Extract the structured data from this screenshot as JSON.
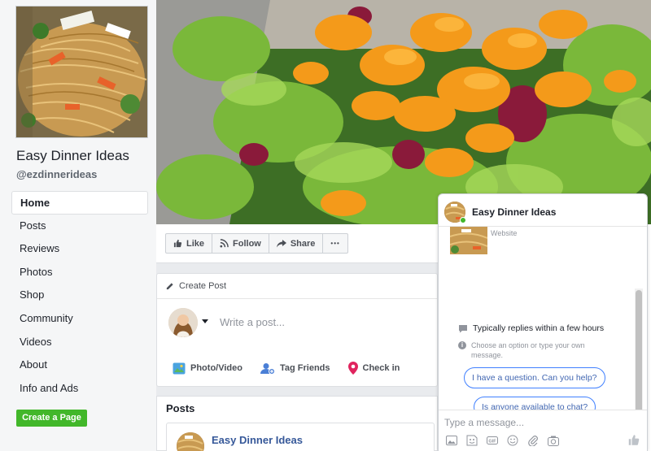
{
  "page": {
    "name": "Easy Dinner Ideas",
    "handle": "@ezdinnerideas"
  },
  "nav": {
    "items": [
      {
        "label": "Home",
        "active": true
      },
      {
        "label": "Posts"
      },
      {
        "label": "Reviews"
      },
      {
        "label": "Photos"
      },
      {
        "label": "Shop"
      },
      {
        "label": "Community"
      },
      {
        "label": "Videos"
      },
      {
        "label": "About"
      },
      {
        "label": "Info and Ads"
      }
    ],
    "create_page_label": "Create a Page"
  },
  "actions": {
    "like_label": "Like",
    "follow_label": "Follow",
    "share_label": "Share",
    "more_label": "•••"
  },
  "create_post": {
    "title": "Create Post",
    "placeholder": "Write a post...",
    "photo_video_label": "Photo/Video",
    "tag_friends_label": "Tag Friends",
    "check_in_label": "Check in"
  },
  "posts": {
    "title": "Posts",
    "first_author": "Easy Dinner Ideas"
  },
  "chat": {
    "title": "Easy Dinner Ideas",
    "site_label": "Website",
    "reply_note": "Typically replies within a few hours",
    "option_note": "Choose an option or type your own message.",
    "question_1": "I have a question. Can you help?",
    "question_2": "Is anyone available to chat?",
    "input_placeholder": "Type a message..."
  },
  "colors": {
    "accent_blue": "#4267b2",
    "link_blue": "#365899",
    "green": "#42b72a",
    "background": "#e9ebee"
  }
}
